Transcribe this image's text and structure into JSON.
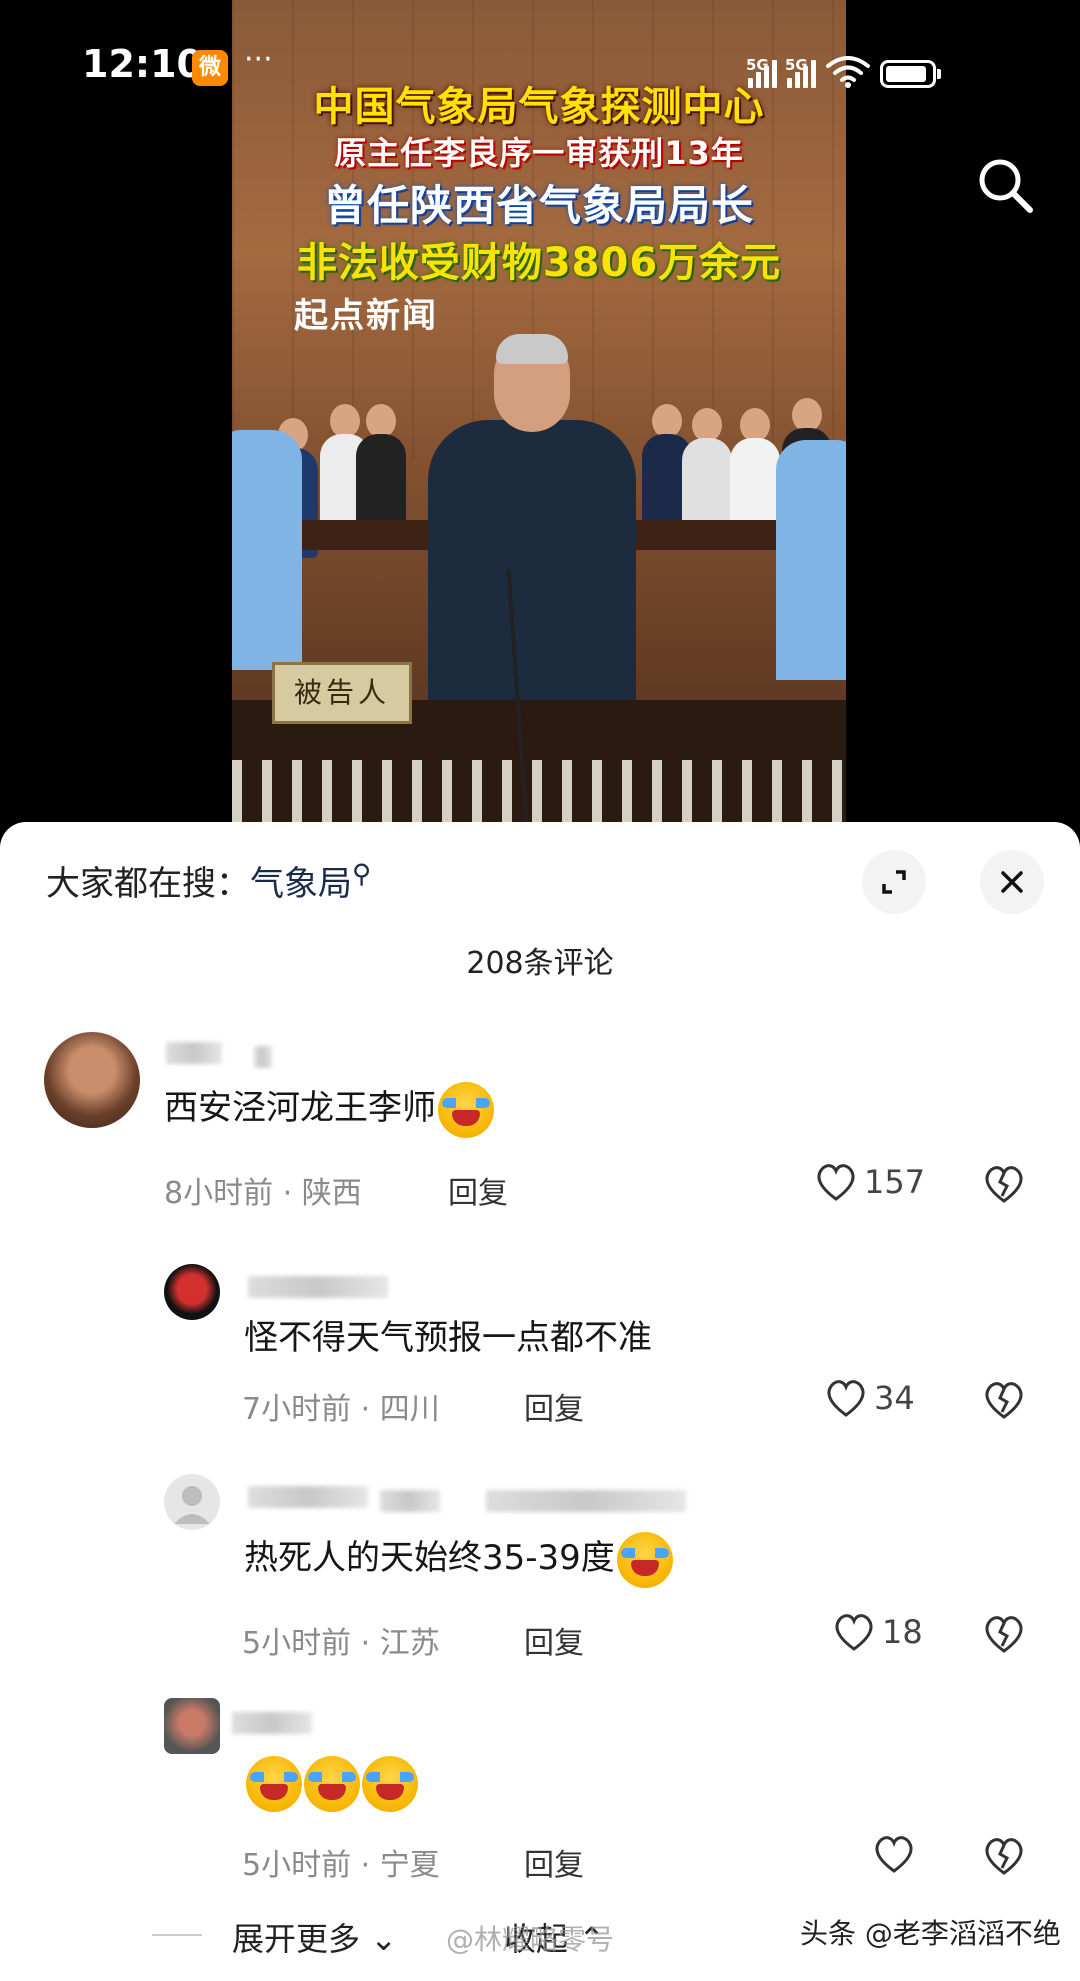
{
  "status_bar": {
    "time": "12:10",
    "app_badge": "微",
    "more": "···",
    "network_1": "5G",
    "network_2": "5G"
  },
  "video": {
    "headline_1": "中国气象局气象探测中心",
    "headline_2": "原主任李良序一审获刑13年",
    "headline_3": "曾任陕西省气象局局长",
    "headline_4": "非法收受财物3806万余元",
    "source_logo": "起点新闻",
    "dock_sign": "被告人"
  },
  "sheet": {
    "hot_search_prefix": "大家都在搜：",
    "hot_search_keyword": "气象局",
    "comment_count": "208条评论"
  },
  "comments": [
    {
      "text": "西安泾河龙王李师",
      "time": "8小时前",
      "location": "陕西",
      "reply_label": "回复",
      "likes": "157"
    },
    {
      "text": "怪不得天气预报一点都不准",
      "time": "7小时前",
      "location": "四川",
      "reply_label": "回复",
      "likes": "34"
    },
    {
      "text": "热死人的天始终35-39度",
      "time": "5小时前",
      "location": "江苏",
      "reply_label": "回复",
      "likes": "18"
    },
    {
      "text": "",
      "time": "5小时前",
      "location": "宁夏",
      "reply_label": "回复",
      "likes": ""
    }
  ],
  "footer": {
    "expand_more": "展开更多",
    "collapse": "收起",
    "watermark_weibo": "@林耀略零号",
    "watermark_toutiao": "头条 @老李滔滔不绝"
  },
  "colors": {
    "headline_yellow": "#ffe200",
    "sheet_bg": "#ffffff",
    "meta_gray": "#8a8a8a"
  }
}
